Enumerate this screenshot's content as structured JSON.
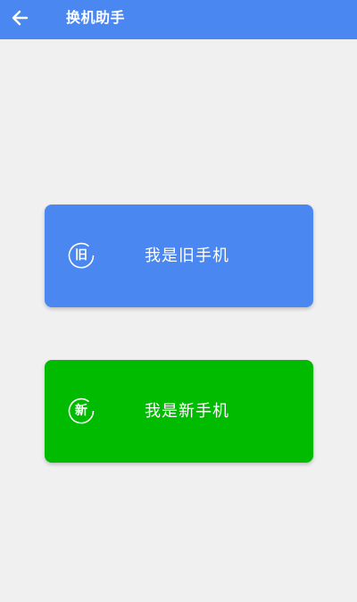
{
  "header": {
    "title": "换机助手",
    "background": "#4a87f0"
  },
  "cards": {
    "old_phone": {
      "badge_char": "旧",
      "label": "我是旧手机",
      "color": "#4a87f0"
    },
    "new_phone": {
      "badge_char": "新",
      "label": "我是新手机",
      "color": "#00bb00"
    }
  }
}
